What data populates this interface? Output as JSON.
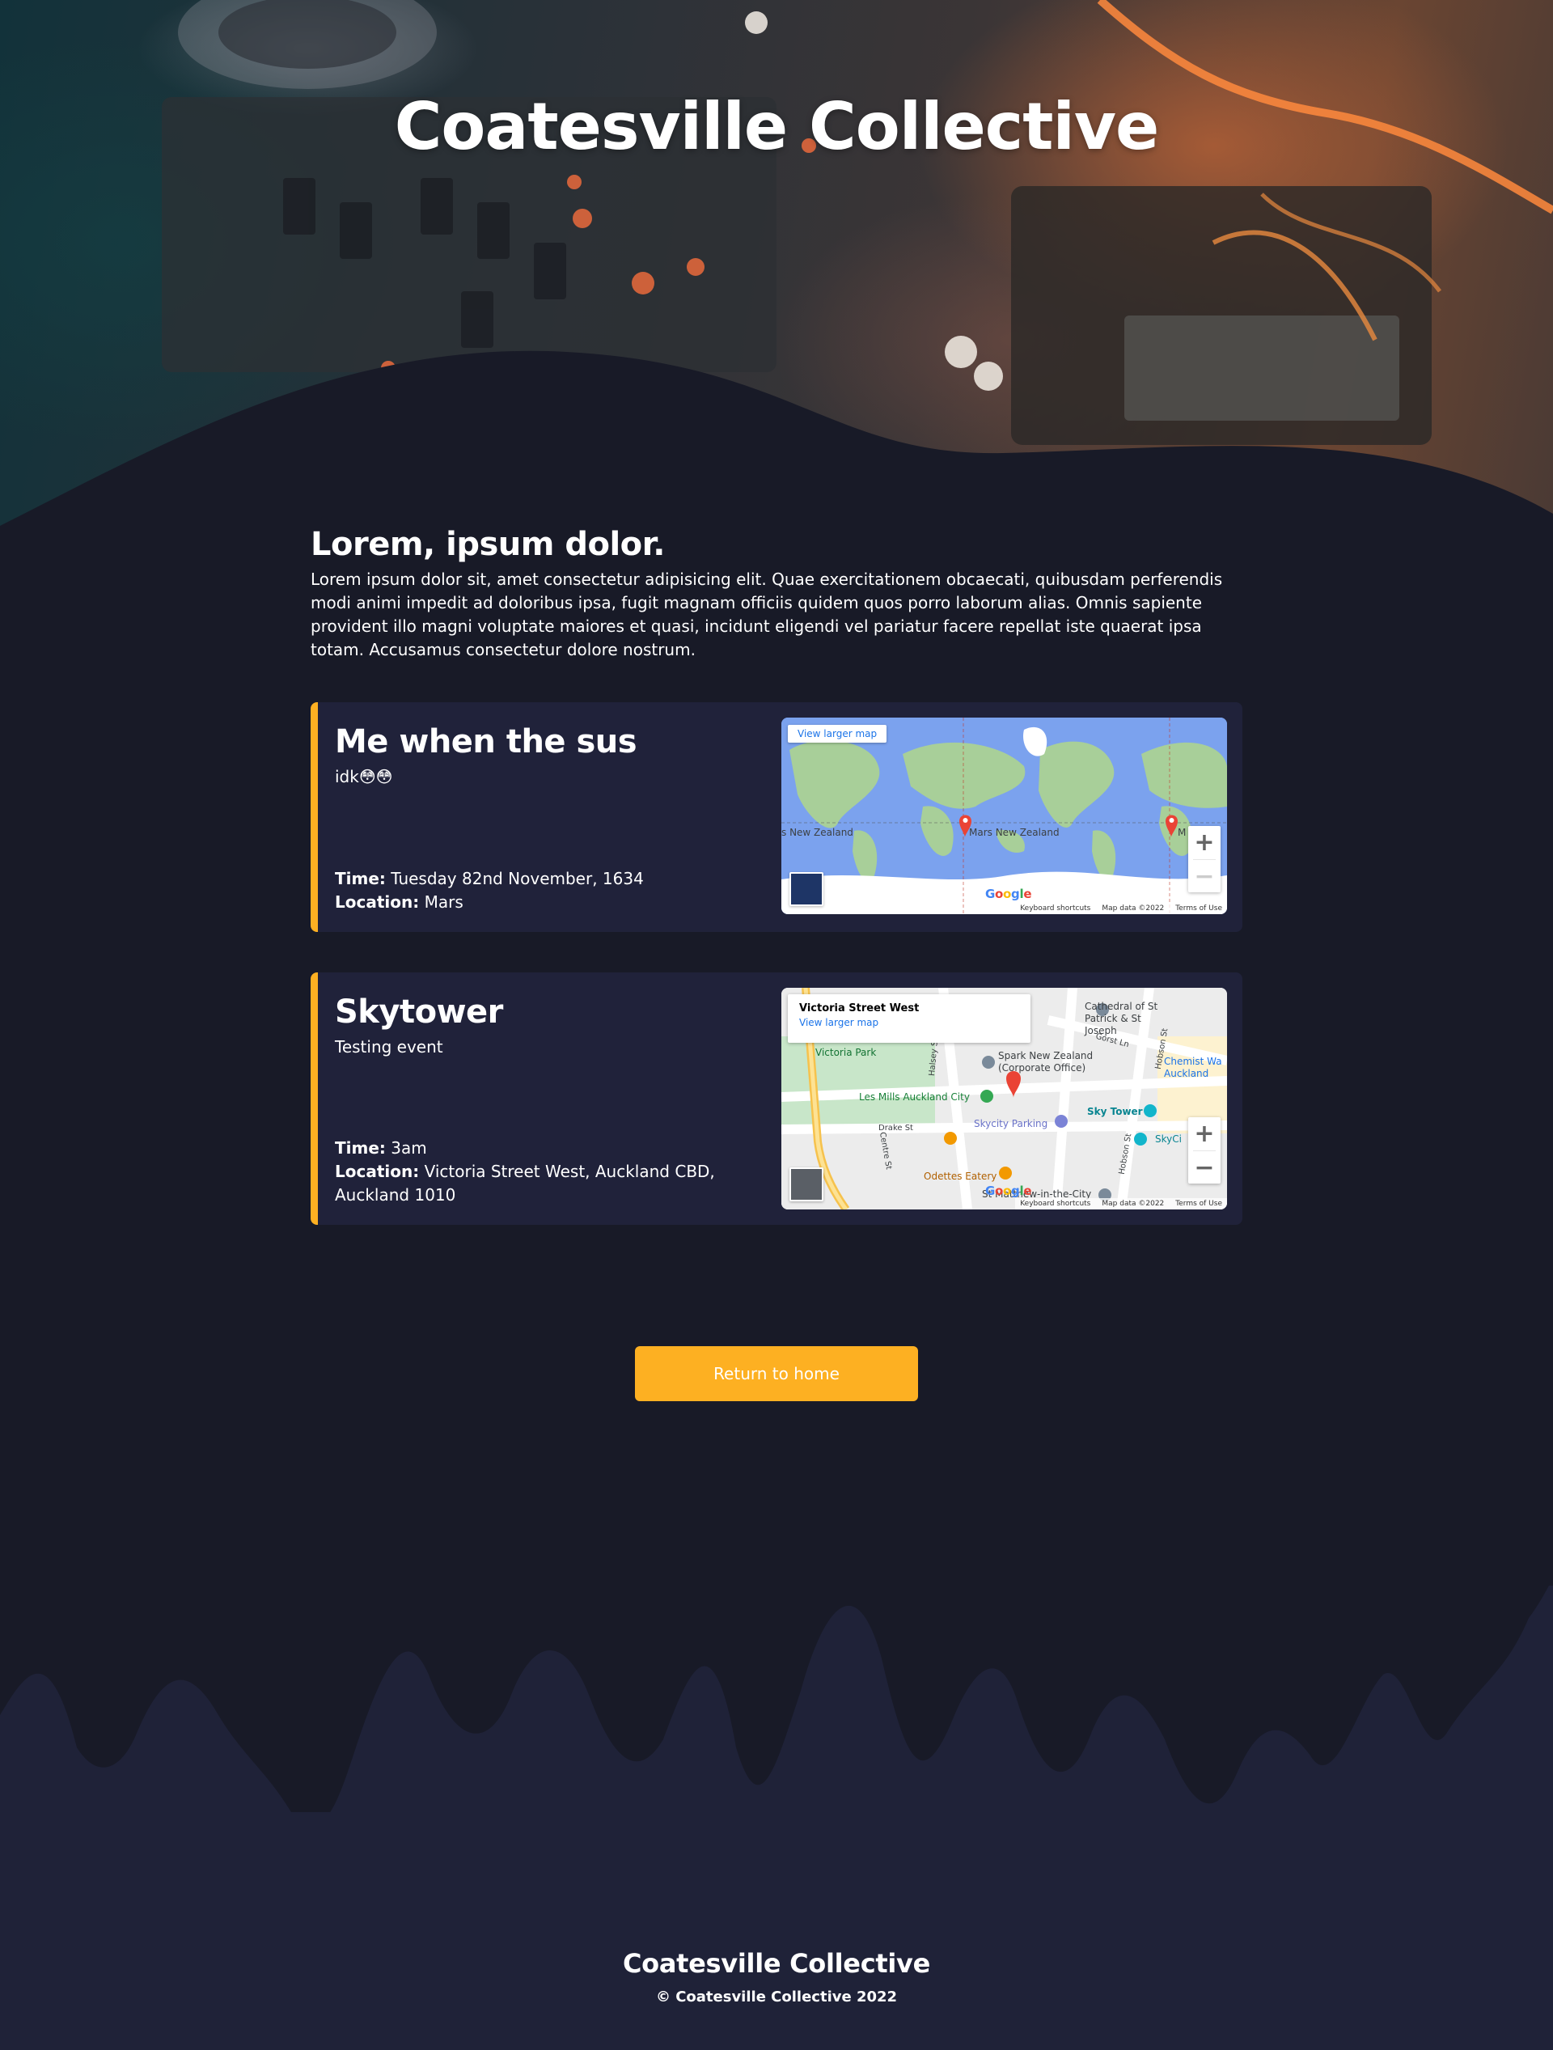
{
  "hero": {
    "title": "Coatesville Collective"
  },
  "intro": {
    "heading": "Lorem, ipsum dolor.",
    "body": "Lorem ipsum dolor sit, amet consectetur adipisicing elit. Quae exercitationem obcaecati, quibusdam perferendis modi animi impedit ad doloribus ipsa, fugit magnam officiis quidem quos porro laborum alias. Omnis sapiente provident illo magni voluptate maiores et quasi, incidunt eligendi vel pariatur facere repellat iste quaerat ipsa totam. Accusamus consectetur dolore nostrum."
  },
  "events": [
    {
      "title": "Me when the sus",
      "description": "idk😳😳",
      "time_label": "Time:",
      "time": "Tuesday 82nd November, 1634",
      "location_label": "Location:",
      "location": "Mars",
      "map": {
        "larger_map_link": "View larger map",
        "labels": [
          "s New Zealand",
          "Mars New Zealand",
          "M"
        ],
        "zoom_in": "+",
        "zoom_out": "−",
        "footer": [
          "Keyboard shortcuts",
          "Map data ©2022",
          "Terms of Use"
        ]
      }
    },
    {
      "title": "Skytower",
      "description": "Testing event",
      "time_label": "Time:",
      "time": "3am",
      "location_label": "Location:",
      "location": "Victoria Street West, Auckland CBD, Auckland 1010",
      "map": {
        "place_title": "Victoria Street West",
        "larger_map_link": "View larger map",
        "labels": {
          "park": "Victoria Park",
          "cathedral": "Cathedral of St Patrick & St Joseph",
          "spark": "Spark New Zealand (Corporate Office)",
          "gym": "Les Mills Auckland City",
          "chemist": "Chemist Wa Auckland",
          "skytower": "Sky Tower",
          "parking": "Skycity Parking",
          "drake": "Drake St",
          "centre": "Centre St",
          "hobson1": "Hobson St",
          "hobson2": "Hobson St",
          "halsey": "Halsey St",
          "gorst": "Gorst Ln",
          "odettes": "Odettes Eatery",
          "matthew": "St Matthew-in-the-City",
          "skycity": "SkyCi"
        },
        "zoom_in": "+",
        "zoom_out": "−",
        "footer": [
          "Keyboard shortcuts",
          "Map data ©2022",
          "Terms of Use"
        ]
      }
    }
  ],
  "actions": {
    "return_home": "Return to home"
  },
  "footer": {
    "title": "Coatesville Collective",
    "copyright": "© Coatesville Collective 2022"
  },
  "colors": {
    "background": "#181a27",
    "card": "#20223a",
    "accent": "#fdb022",
    "footer": "#1f2238"
  },
  "icons": [
    "map-pin-icon",
    "zoom-in-icon",
    "zoom-out-icon",
    "google-logo"
  ]
}
